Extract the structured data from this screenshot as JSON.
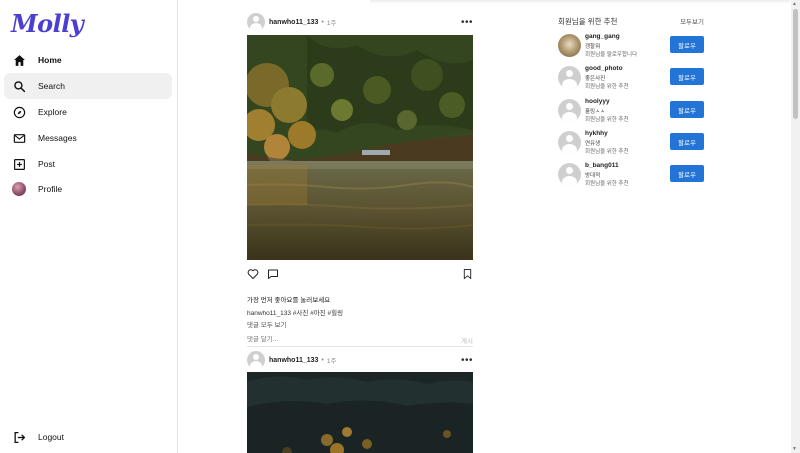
{
  "app": {
    "logo": "Molly"
  },
  "nav": {
    "home": "Home",
    "search": "Search",
    "explore": "Explore",
    "messages": "Messages",
    "post": "Post",
    "profile": "Profile",
    "logout": "Logout"
  },
  "posts": [
    {
      "username": "hanwho11_133",
      "separator": "•",
      "time": "1주",
      "likes_text": "가장 먼저 좋아요를 눌러보세요",
      "caption_user": "hanwho11_133",
      "caption_tags": "#사진 #아진 #힐링",
      "view_comments": "댓글 모두 보기",
      "comment_placeholder": "댓글 달기...",
      "comment_post": "게시"
    },
    {
      "username": "hanwho11_133",
      "separator": "•",
      "time": "1주"
    }
  ],
  "suggestions": {
    "title": "회원님을 위한 추천",
    "see_all": "모두보기",
    "follow_label": "팔로우",
    "items": [
      {
        "name": "gang_gang",
        "sub1": "갱할뭐",
        "sub2": "회원님을 팔로우합니다"
      },
      {
        "name": "good_photo",
        "sub1": "좋은사진",
        "sub2": "회원님을 위한 추천"
      },
      {
        "name": "hoolyyy",
        "sub1": "훌링ㅅㅅ",
        "sub2": "회원님을 위한 추천"
      },
      {
        "name": "hykhhy",
        "sub1": "연유생",
        "sub2": "회원님을 위한 추천"
      },
      {
        "name": "b_bang011",
        "sub1": "방대적",
        "sub2": "회원님을 위한 추천"
      }
    ]
  },
  "colors": {
    "accent": "#2275d7",
    "logo": "#4b3fd1"
  }
}
